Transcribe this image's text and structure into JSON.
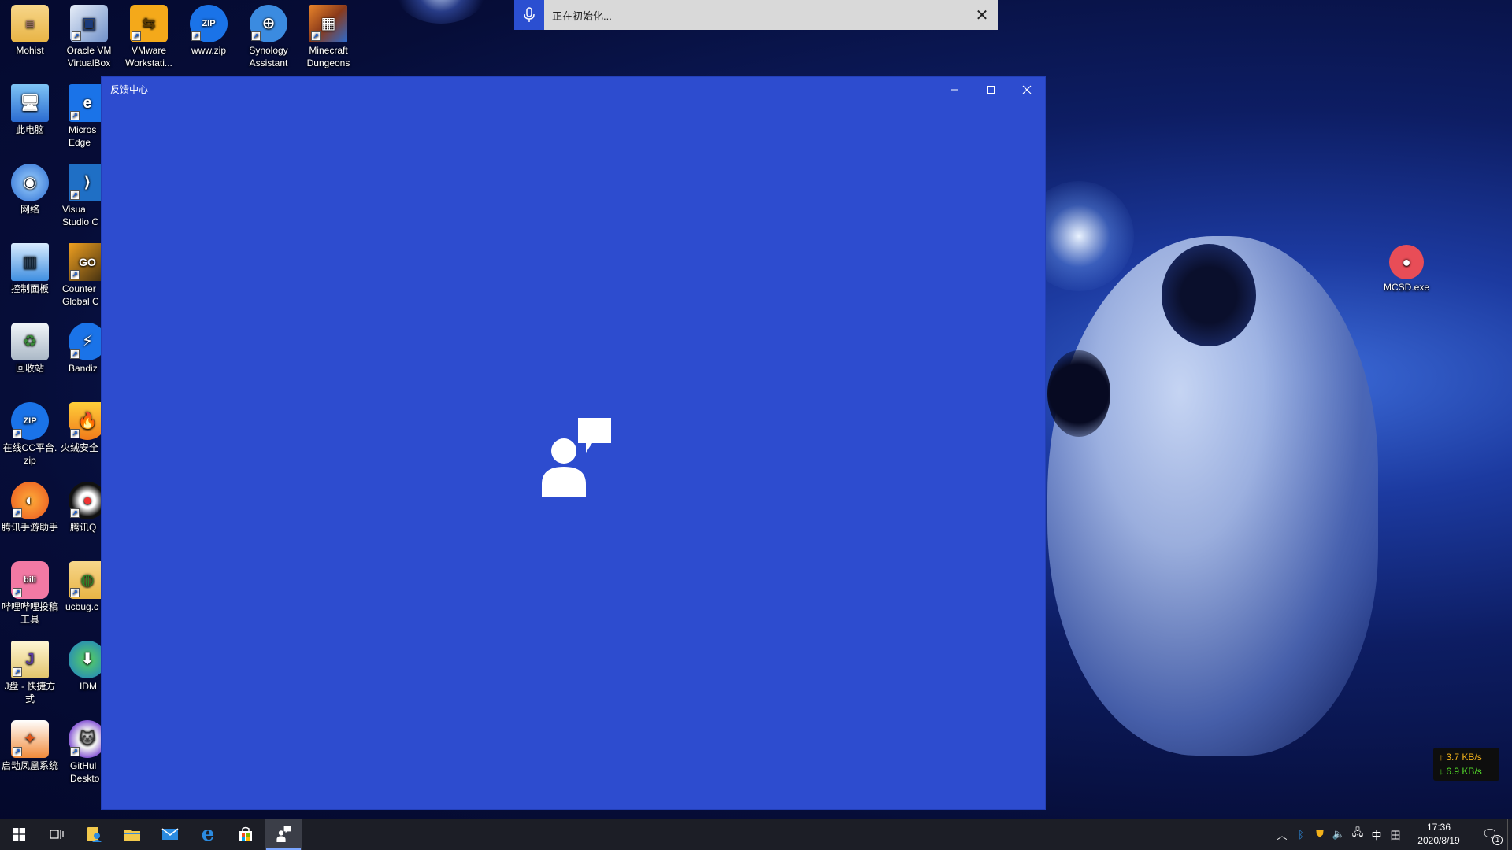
{
  "desktop": {
    "icons": [
      {
        "label": "Mohist"
      },
      {
        "label": "Oracle VM\nVirtualBox"
      },
      {
        "label": "VMware\nWorkstati..."
      },
      {
        "label": "www.zip"
      },
      {
        "label": "Synology\nAssistant"
      },
      {
        "label": "Minecraft\nDungeons"
      },
      {
        "label": "此电脑"
      },
      {
        "label": "Micros\nEdge"
      },
      {
        "label": "网络"
      },
      {
        "label": "Visua\nStudio C"
      },
      {
        "label": "控制面板"
      },
      {
        "label": "Counter\nGlobal C"
      },
      {
        "label": "回收站"
      },
      {
        "label": "Bandiz"
      },
      {
        "label": "在线CC平台.\nzip"
      },
      {
        "label": "火绒安全"
      },
      {
        "label": "腾讯手游助手"
      },
      {
        "label": "腾讯Q"
      },
      {
        "label": "哔哩哔哩投稿\n工具"
      },
      {
        "label": "ucbug.c"
      },
      {
        "label": "J盘 - 快捷方\n式"
      },
      {
        "label": "IDM"
      },
      {
        "label": "启动凤凰系统"
      },
      {
        "label": "GitHul\nDeskto"
      },
      {
        "label": "MCSD.exe"
      }
    ]
  },
  "speech": {
    "status": "正在初始化..."
  },
  "window": {
    "title": "反馈中心"
  },
  "network": {
    "up": "↑ 3.7 KB/s",
    "down": "↓ 6.9 KB/s"
  },
  "tray": {
    "ime": "中",
    "time": "17:36",
    "date": "2020/8/19",
    "notification_count": "1"
  },
  "colors": {
    "window_bg": "#2d4ccf",
    "taskbar_bg": "#1c1e26",
    "accent": "#2b4fd1"
  }
}
